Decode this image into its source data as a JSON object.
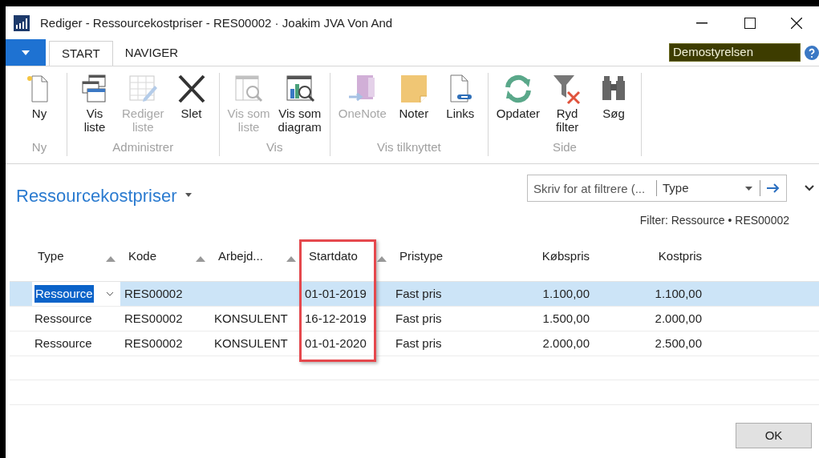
{
  "window": {
    "title": "Rediger - Ressourcekostpriser - RES00002 · Joakim JVA Von And"
  },
  "tabs": [
    {
      "label": "START",
      "selected": true
    },
    {
      "label": "NAVIGER",
      "selected": false
    }
  ],
  "company": "Demostyrelsen",
  "ribbon": [
    {
      "label": "Ny",
      "items": [
        {
          "label": "Ny",
          "disabled": false
        }
      ]
    },
    {
      "label": "Administrer",
      "items": [
        {
          "label": "Vis\nliste",
          "disabled": false
        },
        {
          "label": "Rediger\nliste",
          "disabled": true
        },
        {
          "label": "Slet",
          "disabled": false
        }
      ]
    },
    {
      "label": "Vis",
      "items": [
        {
          "label": "Vis som\nliste",
          "disabled": true
        },
        {
          "label": "Vis som\ndiagram",
          "disabled": false
        }
      ]
    },
    {
      "label": "Vis tilknyttet",
      "items": [
        {
          "label": "OneNote",
          "disabled": true
        },
        {
          "label": "Noter",
          "disabled": false
        },
        {
          "label": "Links",
          "disabled": false
        }
      ]
    },
    {
      "label": "Side",
      "items": [
        {
          "label": "Opdater",
          "disabled": false
        },
        {
          "label": "Ryd\nfilter",
          "disabled": false
        },
        {
          "label": "Søg",
          "disabled": false
        }
      ]
    }
  ],
  "page_title": "Ressourcekostpriser",
  "filter_box": {
    "placeholder": "Skriv for at filtrere (...",
    "field": "Type"
  },
  "filter_text": "Filter: Ressource • RES00002",
  "table": {
    "columns": [
      {
        "label": "Type",
        "sort_arrow": true,
        "highlighted": false
      },
      {
        "label": "Kode",
        "sort_arrow": true,
        "highlighted": false
      },
      {
        "label": "Arbejd...",
        "sort_arrow": true,
        "highlighted": false
      },
      {
        "label": "Startdato",
        "sort_arrow": true,
        "highlighted": true
      },
      {
        "label": "Pristype",
        "sort_arrow": false,
        "highlighted": false
      },
      {
        "label": "Købspris",
        "sort_arrow": false,
        "highlighted": false
      },
      {
        "label": "Kostpris",
        "sort_arrow": false,
        "highlighted": false
      }
    ],
    "rows": [
      {
        "selected": true,
        "cells": [
          "Ressource",
          "RES00002",
          "",
          "01-01-2019",
          "Fast pris",
          "1.100,00",
          "1.100,00"
        ]
      },
      {
        "selected": false,
        "cells": [
          "Ressource",
          "RES00002",
          "KONSULENT",
          "16-12-2019",
          "Fast pris",
          "1.500,00",
          "2.000,00"
        ]
      },
      {
        "selected": false,
        "cells": [
          "Ressource",
          "RES00002",
          "KONSULENT",
          "01-01-2020",
          "Fast pris",
          "2.000,00",
          "2.500,00"
        ]
      }
    ]
  },
  "buttons": [
    "OK"
  ]
}
